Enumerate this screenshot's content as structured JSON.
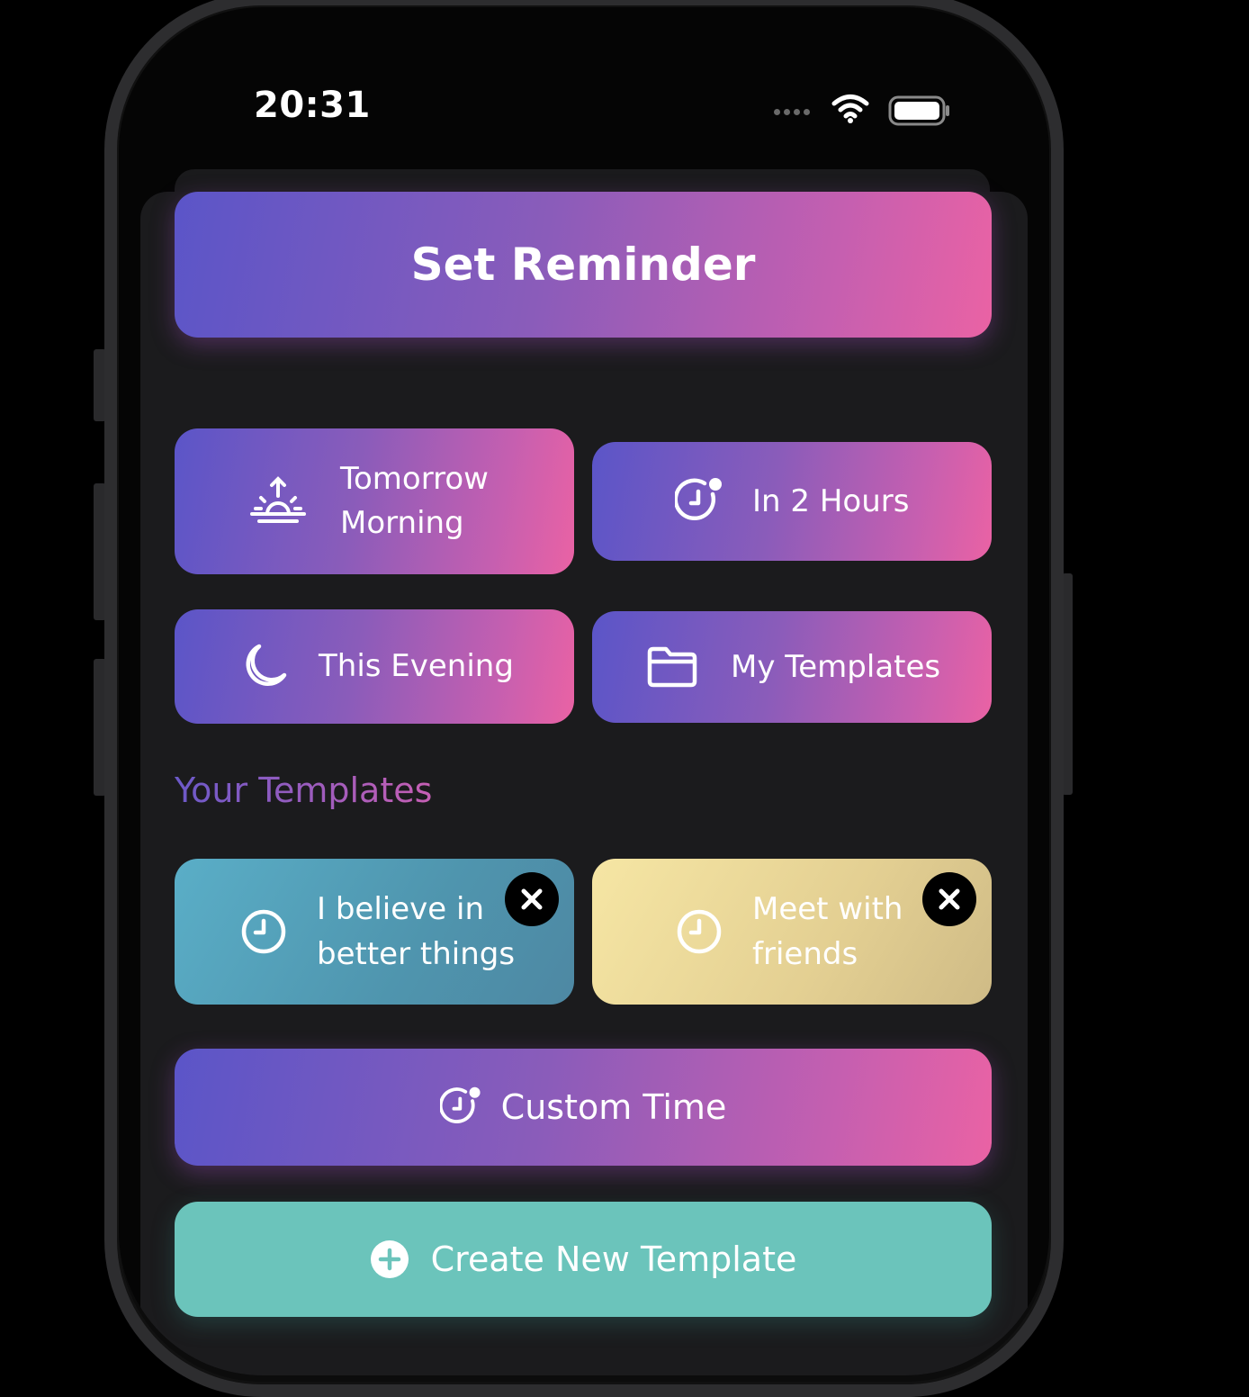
{
  "status_bar": {
    "time": "20:31"
  },
  "main_action": {
    "label": "Set Reminder"
  },
  "quick_options": [
    {
      "line1": "Tomorrow",
      "line2": "Morning",
      "icon": "sunrise-icon"
    },
    {
      "label": "In 2 Hours",
      "icon": "clock-badge-icon"
    },
    {
      "label": "This Evening",
      "icon": "moon-icon"
    },
    {
      "label": "My Templates",
      "icon": "folder-icon"
    }
  ],
  "templates_section": {
    "title": "Your Templates",
    "items": [
      {
        "line1": "I believe in",
        "line2": "better things",
        "icon": "clock-icon",
        "color": "#4f95ae"
      },
      {
        "line1": "Meet with",
        "line2": "friends",
        "icon": "clock-icon",
        "color": "#e3cf92"
      }
    ]
  },
  "custom_time": {
    "label": "Custom Time",
    "icon": "clock-badge-icon"
  },
  "create_template": {
    "label": "Create New Template",
    "icon": "plus-circle-icon"
  },
  "colors": {
    "gradient_start": "#5b55c8",
    "gradient_end": "#ea62a4",
    "teal": "#6bc4bb",
    "sheet": "#1b1b1d"
  }
}
